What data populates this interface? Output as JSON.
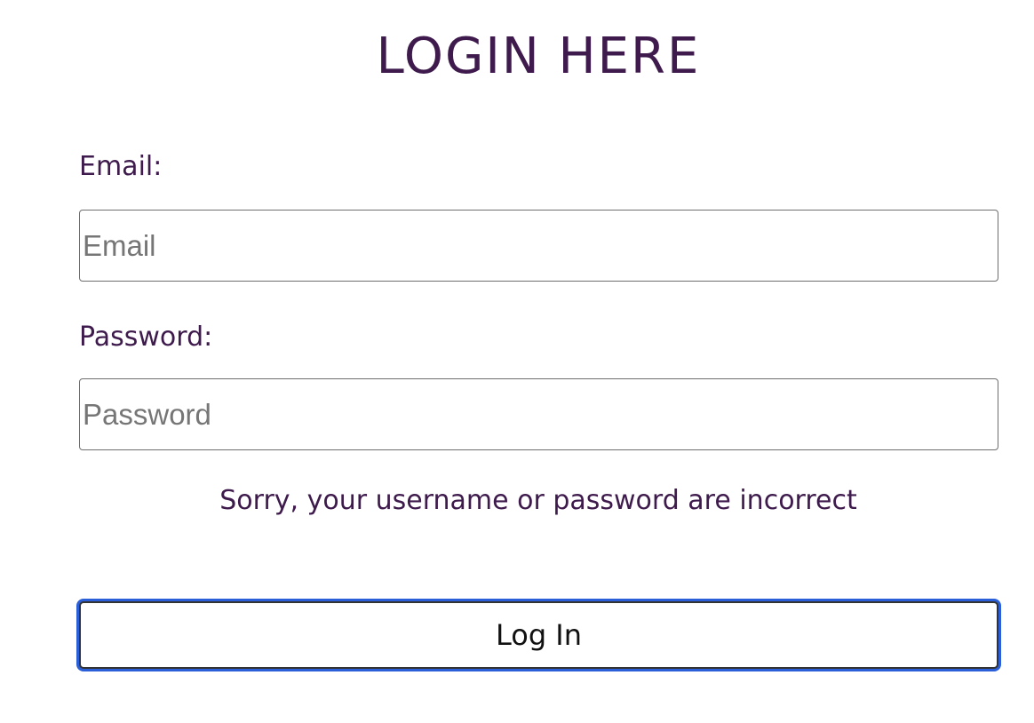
{
  "page": {
    "title": "LOGIN HERE"
  },
  "form": {
    "email_label": "Email:",
    "email_placeholder": "Email",
    "email_value": "",
    "password_label": "Password:",
    "password_placeholder": "Password",
    "password_value": "",
    "error_message": "Sorry, your username or password are incorrect",
    "submit_label": "Log In"
  },
  "colors": {
    "text_primary": "#3e1b4c",
    "input_border": "#6e6e6e",
    "placeholder": "#767676",
    "focus_ring": "#2b5fd9"
  }
}
